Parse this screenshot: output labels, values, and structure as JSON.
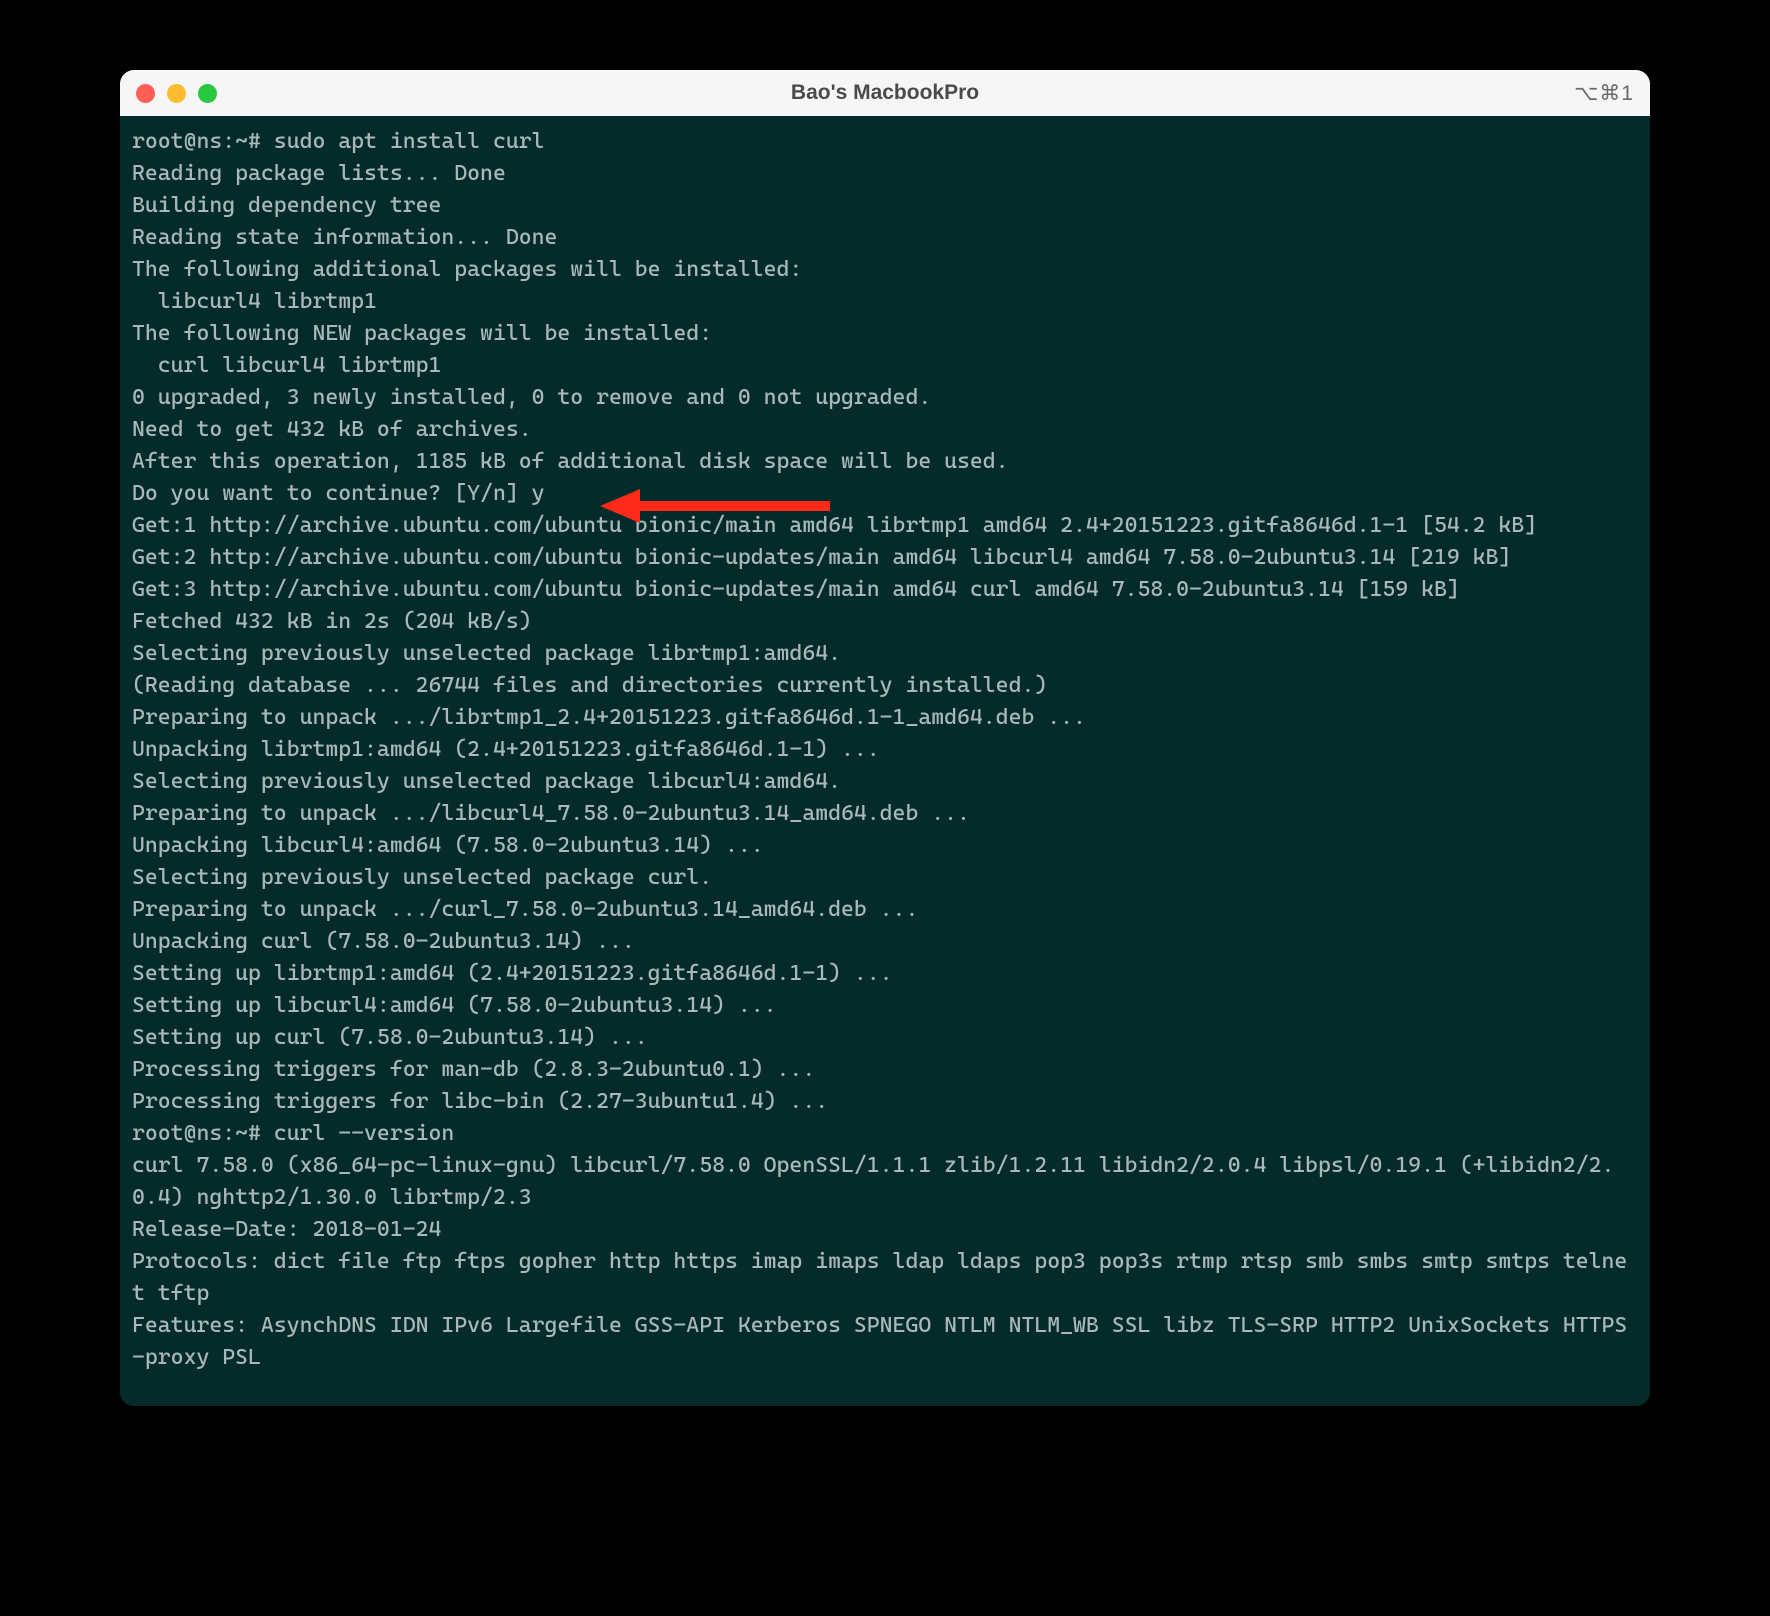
{
  "window": {
    "title": "Bao's MacbookPro",
    "shortcut": "⌥⌘1"
  },
  "annotation": {
    "arrow_color": "#ff2a1a",
    "arrow_target_line_index": 11
  },
  "terminal": {
    "lines": [
      "root@ns:~# sudo apt install curl",
      "Reading package lists... Done",
      "Building dependency tree",
      "Reading state information... Done",
      "The following additional packages will be installed:",
      "  libcurl4 librtmp1",
      "The following NEW packages will be installed:",
      "  curl libcurl4 librtmp1",
      "0 upgraded, 3 newly installed, 0 to remove and 0 not upgraded.",
      "Need to get 432 kB of archives.",
      "After this operation, 1185 kB of additional disk space will be used.",
      "Do you want to continue? [Y/n] y",
      "Get:1 http://archive.ubuntu.com/ubuntu bionic/main amd64 librtmp1 amd64 2.4+20151223.gitfa8646d.1-1 [54.2 kB]",
      "Get:2 http://archive.ubuntu.com/ubuntu bionic-updates/main amd64 libcurl4 amd64 7.58.0-2ubuntu3.14 [219 kB]",
      "Get:3 http://archive.ubuntu.com/ubuntu bionic-updates/main amd64 curl amd64 7.58.0-2ubuntu3.14 [159 kB]",
      "Fetched 432 kB in 2s (204 kB/s)",
      "Selecting previously unselected package librtmp1:amd64.",
      "(Reading database ... 26744 files and directories currently installed.)",
      "Preparing to unpack .../librtmp1_2.4+20151223.gitfa8646d.1-1_amd64.deb ...",
      "Unpacking librtmp1:amd64 (2.4+20151223.gitfa8646d.1-1) ...",
      "Selecting previously unselected package libcurl4:amd64.",
      "Preparing to unpack .../libcurl4_7.58.0-2ubuntu3.14_amd64.deb ...",
      "Unpacking libcurl4:amd64 (7.58.0-2ubuntu3.14) ...",
      "Selecting previously unselected package curl.",
      "Preparing to unpack .../curl_7.58.0-2ubuntu3.14_amd64.deb ...",
      "Unpacking curl (7.58.0-2ubuntu3.14) ...",
      "Setting up librtmp1:amd64 (2.4+20151223.gitfa8646d.1-1) ...",
      "Setting up libcurl4:amd64 (7.58.0-2ubuntu3.14) ...",
      "Setting up curl (7.58.0-2ubuntu3.14) ...",
      "Processing triggers for man-db (2.8.3-2ubuntu0.1) ...",
      "Processing triggers for libc-bin (2.27-3ubuntu1.4) ...",
      "root@ns:~# curl --version",
      "curl 7.58.0 (x86_64-pc-linux-gnu) libcurl/7.58.0 OpenSSL/1.1.1 zlib/1.2.11 libidn2/2.0.4 libpsl/0.19.1 (+libidn2/2.0.4) nghttp2/1.30.0 librtmp/2.3",
      "Release-Date: 2018-01-24",
      "Protocols: dict file ftp ftps gopher http https imap imaps ldap ldaps pop3 pop3s rtmp rtsp smb smbs smtp smtps telnet tftp",
      "Features: AsynchDNS IDN IPv6 Largefile GSS-API Kerberos SPNEGO NTLM NTLM_WB SSL libz TLS-SRP HTTP2 UnixSockets HTTPS-proxy PSL"
    ]
  }
}
